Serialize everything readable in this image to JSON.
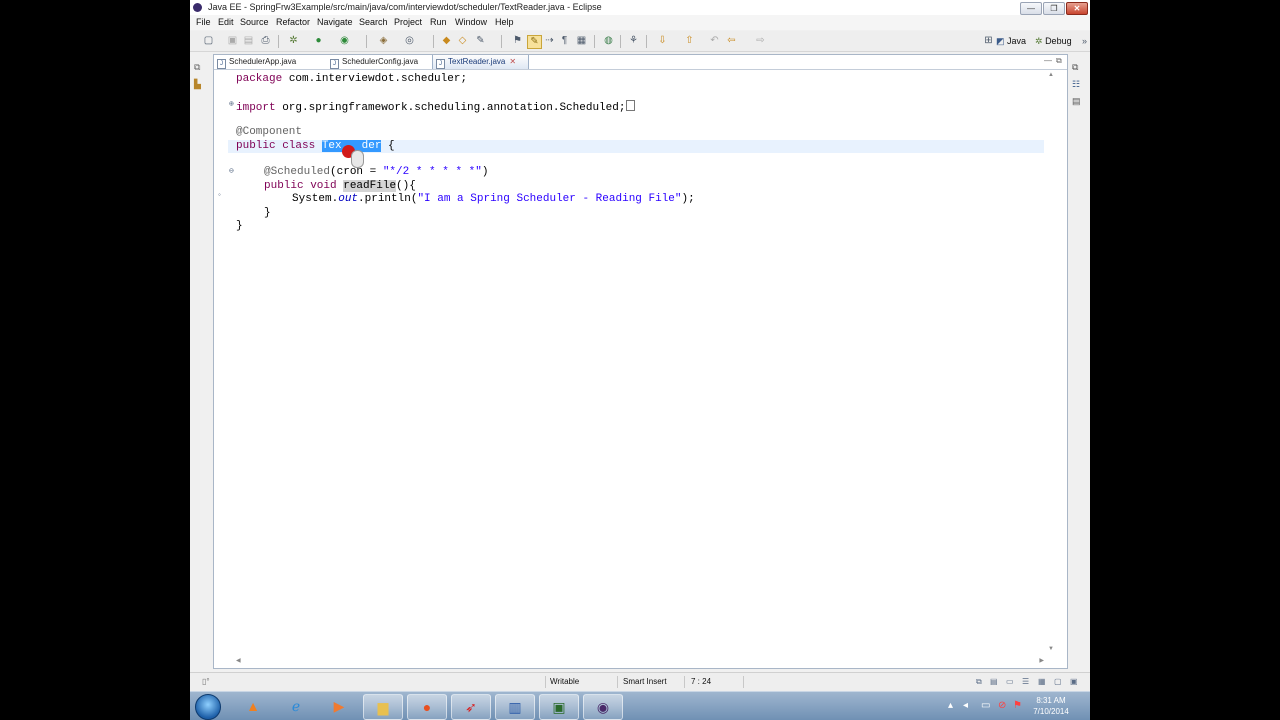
{
  "window": {
    "title": "Java EE - SpringFrw3Example/src/main/java/com/interviewdot/scheduler/TextReader.java - Eclipse",
    "controls": [
      "—",
      "❐",
      "✕"
    ]
  },
  "menubar": {
    "items": [
      "File",
      "Edit",
      "Source",
      "Refactor",
      "Navigate",
      "Search",
      "Project",
      "Run",
      "Window",
      "Help"
    ]
  },
  "toolbar": {
    "icons": [
      "new-icon",
      "save-icon",
      "save-all-icon",
      "print-icon",
      "debug-icon",
      "run-icon",
      "external-tools-icon",
      "new-class-icon",
      "open-type-icon",
      "open-task-icon",
      "search-icon",
      "annotation-icon",
      "mark-occurrences-icon",
      "forward-icon",
      "show-whitespace-icon",
      "block-selection-icon",
      "globe-icon",
      "link-icon",
      "next-annotation-icon",
      "previous-annotation-icon",
      "last-edit-icon",
      "back-icon",
      "forward-nav-icon"
    ],
    "perspectives": {
      "java": "Java",
      "debug": "Debug"
    }
  },
  "editor": {
    "tabs": [
      {
        "label": "SchedulerApp.java",
        "active": false
      },
      {
        "label": "SchedulerConfig.java",
        "active": false
      },
      {
        "label": "TextReader.java",
        "active": true
      }
    ],
    "code": {
      "l1_kw": "package",
      "l1_rest": " com.interviewdot.scheduler;",
      "l2_kw": "import",
      "l2_rest": " org.springframework.scheduling.annotation.Scheduled;",
      "l3_ann": "@Component",
      "l4_kw": "public class",
      "l4_sel_a": "Tex",
      "l4_sel_b": "der",
      "l4_rest": " {",
      "l5_ann": "@Scheduled",
      "l5_mid": "(cron = ",
      "l5_str": "\"*/2 * * * * *\"",
      "l5_end": ")",
      "l6_kw": "public void",
      "l6_name": "readFile",
      "l6_rest": "(){",
      "l7_pre": "System.",
      "l7_fld": "out",
      "l7_mid": ".println(",
      "l7_str": "\"I am a Spring Scheduler - Reading File\"",
      "l7_end": ");",
      "l8": "}",
      "l9": "}"
    }
  },
  "status": {
    "writable": "Writable",
    "insert_mode": "Smart Insert",
    "position": "7 : 24"
  },
  "taskbar": {
    "time": "8:31 AM",
    "date": "7/10/2014"
  }
}
